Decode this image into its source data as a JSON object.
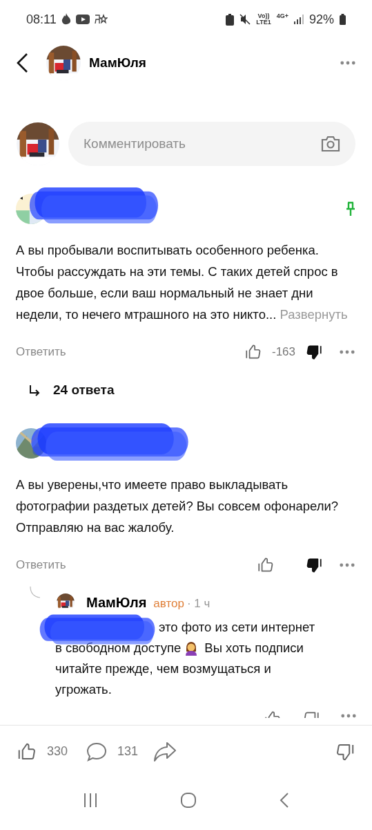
{
  "status_bar": {
    "time": "08:11",
    "volte": "Vo))",
    "lte": "LTE1",
    "network": "4G+",
    "battery": "92%"
  },
  "header": {
    "title": "МамЮля"
  },
  "comment_input": {
    "placeholder": "Комментировать"
  },
  "comments": [
    {
      "kind": "comment",
      "pinned": true,
      "text": "А вы пробывали воспитывать особенного ребенка. Чтобы рассуждать на эти темы. С таких детей спрос в двое больше, если ваш нормальный не знает дни недели, то нечего мтрашного на это никто...",
      "more": "Развернуть",
      "reply": "Ответить",
      "score": "-163",
      "disliked": true,
      "replies": "24 ответа"
    },
    {
      "kind": "comment",
      "pinned": false,
      "text": "А вы уверены,что имеете право выкладывать фотографии раздетых детей? Вы совсем офонарели? Отправляю на вас жалобу.",
      "reply": "Ответить",
      "disliked": true
    },
    {
      "kind": "reply",
      "author": "МамЮля",
      "badge": "автор",
      "time": "· 1 ч",
      "text_parts": [
        "это фото из сети интернет",
        "в свободном доступе",
        "Вы хоть подписи",
        "читайте прежде, чем возмущаться и угрожать."
      ],
      "disliked": false
    }
  ],
  "bottom_bar": {
    "likes": "330",
    "comments": "131"
  }
}
